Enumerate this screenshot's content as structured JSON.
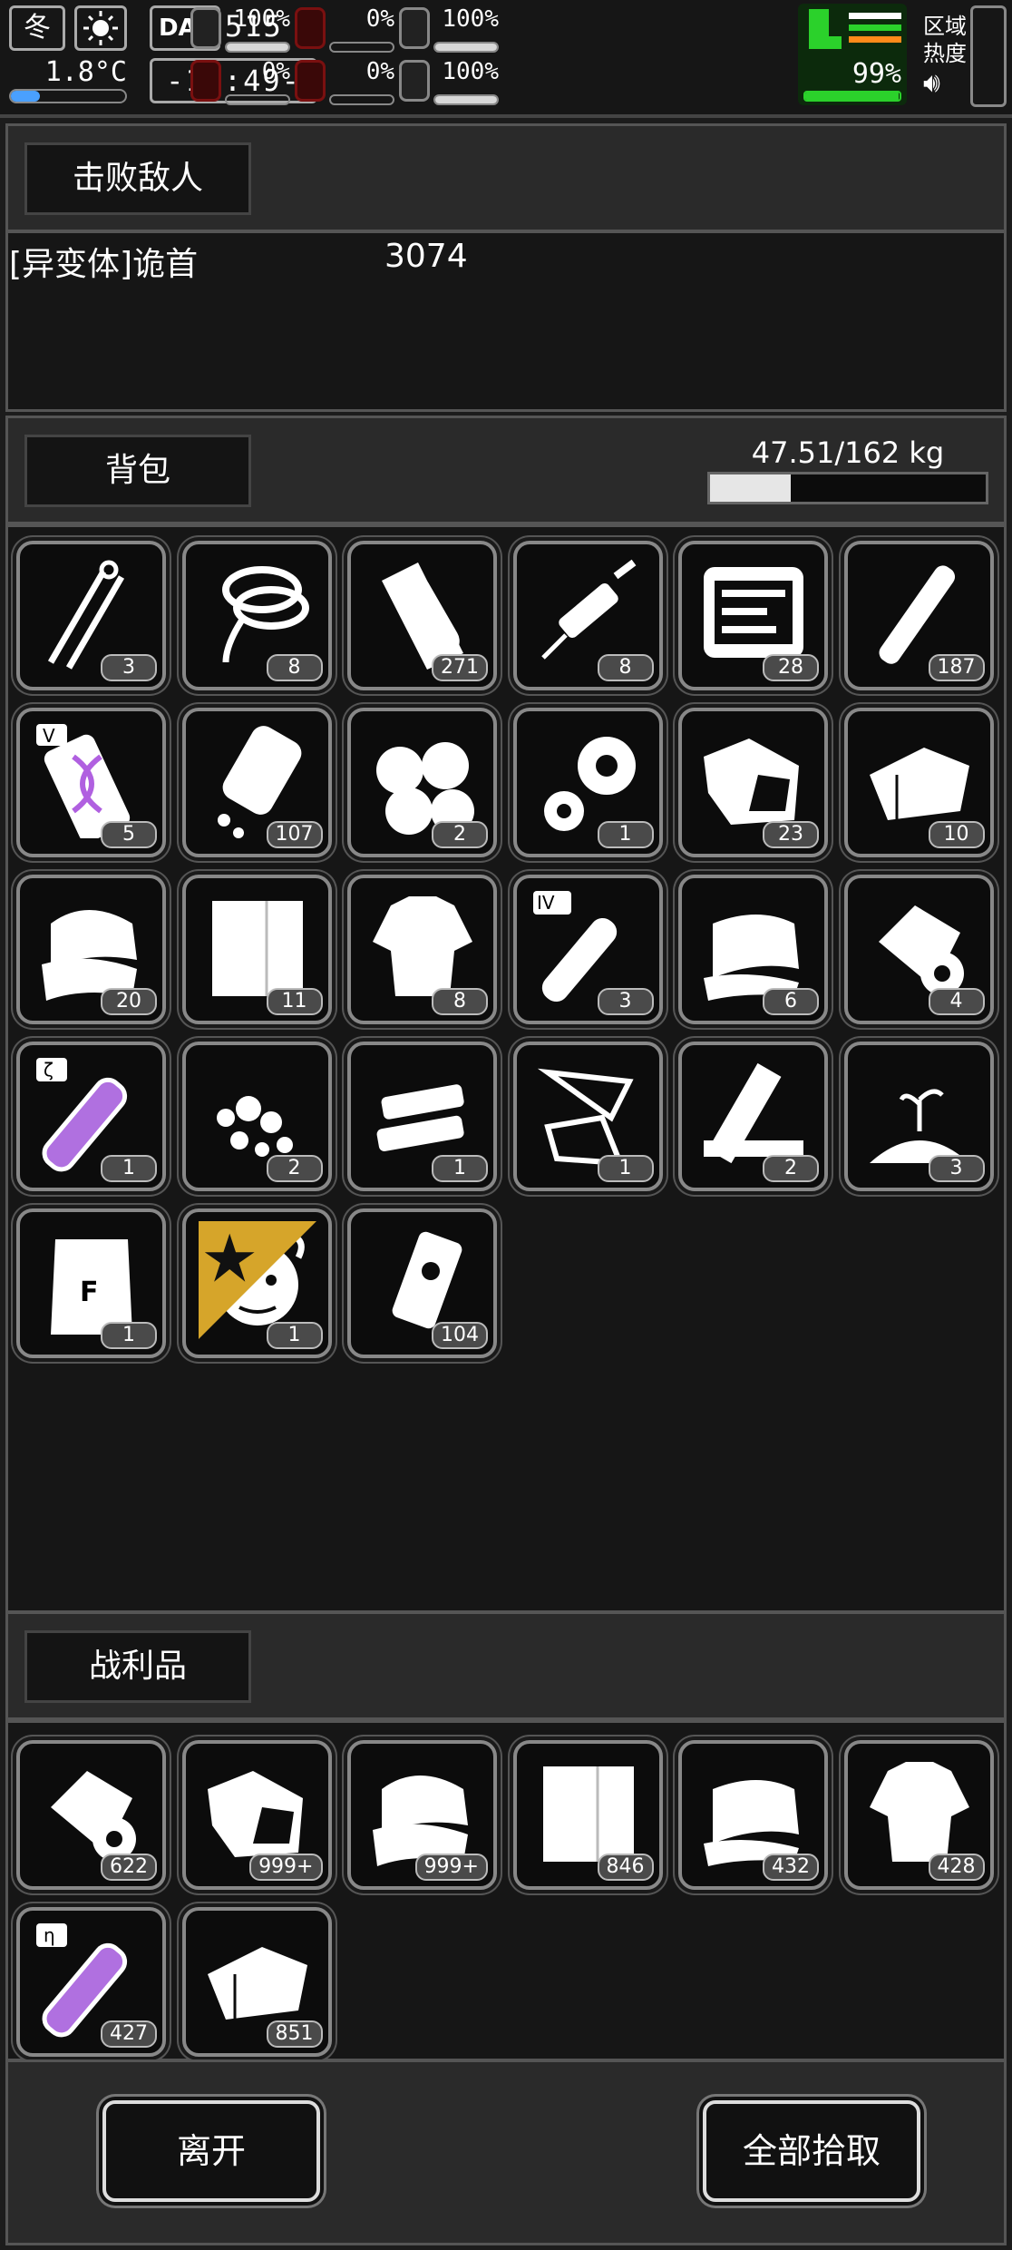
{
  "status": {
    "season": "冬",
    "temperature": "1.8°C",
    "temperature_level": 0.25,
    "day_label": "DAY",
    "day_number": "515",
    "clock": "-17:49-",
    "stats": [
      {
        "icon": "medkit-icon",
        "value": "100%",
        "level": 1.0
      },
      {
        "icon": "stomach-icon",
        "value": "0%",
        "level": 0.0
      },
      {
        "icon": "pill-icon",
        "value": "100%",
        "level": 1.0
      },
      {
        "icon": "brain-icon",
        "value": "0%",
        "level": 0.0
      },
      {
        "icon": "blood-drop-icon",
        "value": "0%",
        "level": 0.0
      },
      {
        "icon": "heart-icon",
        "value": "100%",
        "level": 1.0
      }
    ],
    "stamina": {
      "value": "99%",
      "level": 0.99
    },
    "region_label_1": "区域",
    "region_label_2": "热度"
  },
  "defeated": {
    "header": "击败敌人",
    "enemy_name": "[异变体]诡首",
    "enemy_score": "3074"
  },
  "backpack": {
    "header": "背包",
    "weight": "47.51/162 kg",
    "weight_level": 0.2933,
    "items": [
      {
        "icon": "lockpick-icon",
        "count": "3"
      },
      {
        "icon": "rope-icon",
        "count": "8"
      },
      {
        "icon": "paper-roll-icon",
        "count": "271"
      },
      {
        "icon": "syringe-icon",
        "count": "8"
      },
      {
        "icon": "toolkit-icon",
        "count": "28"
      },
      {
        "icon": "cigarette-icon",
        "count": "187"
      },
      {
        "icon": "dna-vial-icon",
        "count": "5"
      },
      {
        "icon": "pill-bottle-icon",
        "count": "107"
      },
      {
        "icon": "cotton-balls-icon",
        "count": "2"
      },
      {
        "icon": "gears-icon",
        "count": "1"
      },
      {
        "icon": "ore-chunk-icon",
        "count": "23"
      },
      {
        "icon": "cloth-icon",
        "count": "10"
      },
      {
        "icon": "towel-icon",
        "count": "20"
      },
      {
        "icon": "sheet-icon",
        "count": "11"
      },
      {
        "icon": "ragged-shirt-icon",
        "count": "8"
      },
      {
        "icon": "test-tube-iv-icon",
        "count": "3"
      },
      {
        "icon": "fabric-icon",
        "count": "6"
      },
      {
        "icon": "bandage-roll-icon",
        "count": "4"
      },
      {
        "icon": "test-tube-zeta-icon",
        "count": "1"
      },
      {
        "icon": "rubble-icon",
        "count": "2"
      },
      {
        "icon": "plates-icon",
        "count": "1"
      },
      {
        "icon": "glass-shards-icon",
        "count": "1"
      },
      {
        "icon": "planks-icon",
        "count": "2"
      },
      {
        "icon": "soil-sprout-icon",
        "count": "3"
      },
      {
        "icon": "flour-sack-icon",
        "count": "1",
        "label": "F"
      },
      {
        "icon": "medusa-head-icon",
        "count": "1",
        "badge": "star-badge"
      },
      {
        "icon": "fuel-can-icon",
        "count": "104"
      }
    ]
  },
  "loot": {
    "header": "战利品",
    "items": [
      {
        "icon": "bandage-roll-icon",
        "count": "622"
      },
      {
        "icon": "ore-chunk-icon",
        "count": "999+"
      },
      {
        "icon": "towel-icon",
        "count": "999+"
      },
      {
        "icon": "sheet-icon",
        "count": "846"
      },
      {
        "icon": "fabric-icon",
        "count": "432"
      },
      {
        "icon": "ragged-shirt-icon",
        "count": "428"
      },
      {
        "icon": "test-tube-eta-icon",
        "count": "427"
      },
      {
        "icon": "cloth-icon",
        "count": "851"
      }
    ]
  },
  "footer": {
    "leave_label": "离开",
    "take_all_label": "全部拾取"
  },
  "colors": {
    "background": "#1c1c1c",
    "panel": "#2a2a2a",
    "stamina_green": "#2bd12b",
    "danger_red": "#7a1010",
    "temp_blue": "#4aa0ff",
    "badge_gold": "#d6a52a"
  }
}
